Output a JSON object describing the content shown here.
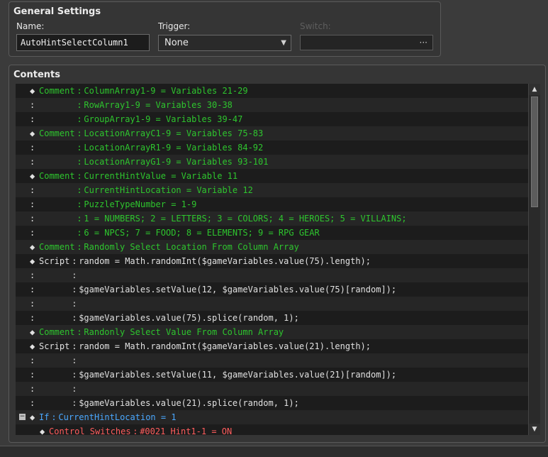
{
  "general": {
    "title": "General Settings",
    "name_label": "Name:",
    "name_value": "AutoHintSelectColumn1",
    "trigger_label": "Trigger:",
    "trigger_value": "None",
    "switch_label": "Switch:",
    "switch_dots": "···"
  },
  "contents": {
    "title": "Contents",
    "rows": [
      {
        "marker": "◆",
        "cmd": "Comment",
        "sep": ":",
        "text": "ColumnArray1-9 = Variables 21-29",
        "color": "green",
        "indent": 0
      },
      {
        "marker": ":",
        "cmd": "",
        "sep": ":",
        "text": "RowArray1-9 = Variables 30-38",
        "color": "green",
        "indent": 0
      },
      {
        "marker": ":",
        "cmd": "",
        "sep": ":",
        "text": "GroupArray1-9 = Variables 39-47",
        "color": "green",
        "indent": 0
      },
      {
        "marker": "◆",
        "cmd": "Comment",
        "sep": ":",
        "text": "LocationArrayC1-9 = Variables 75-83",
        "color": "green",
        "indent": 0
      },
      {
        "marker": ":",
        "cmd": "",
        "sep": ":",
        "text": "LocationArrayR1-9 = Variables 84-92",
        "color": "green",
        "indent": 0
      },
      {
        "marker": ":",
        "cmd": "",
        "sep": ":",
        "text": "LocationArrayG1-9 = Variables 93-101",
        "color": "green",
        "indent": 0
      },
      {
        "marker": "◆",
        "cmd": "Comment",
        "sep": ":",
        "text": "CurrentHintValue = Variable 11",
        "color": "green",
        "indent": 0
      },
      {
        "marker": ":",
        "cmd": "",
        "sep": ":",
        "text": "CurrentHintLocation = Variable 12",
        "color": "green",
        "indent": 0
      },
      {
        "marker": ":",
        "cmd": "",
        "sep": ":",
        "text": "PuzzleTypeNumber = 1-9",
        "color": "green",
        "indent": 0
      },
      {
        "marker": ":",
        "cmd": "",
        "sep": ":",
        "text": "1 = NUMBERS; 2 = LETTERS; 3 = COLORS; 4 = HEROES; 5 = VILLAINS;",
        "color": "green",
        "indent": 0
      },
      {
        "marker": ":",
        "cmd": "",
        "sep": ":",
        "text": "6 = NPCS; 7 = FOOD; 8 = ELEMENTS; 9 = RPG GEAR",
        "color": "green",
        "indent": 0
      },
      {
        "marker": "◆",
        "cmd": "Comment",
        "sep": ":",
        "text": "Randomly Select Location From Column Array",
        "color": "green",
        "indent": 0
      },
      {
        "marker": "◆",
        "cmd": "Script",
        "sep": ":",
        "text": "random = Math.randomInt($gameVariables.value(75).length);",
        "color": "white",
        "indent": 0
      },
      {
        "marker": ":",
        "cmd": "",
        "sep": ":",
        "text": "",
        "color": "white",
        "indent": 0
      },
      {
        "marker": ":",
        "cmd": "",
        "sep": ":",
        "text": "$gameVariables.setValue(12, $gameVariables.value(75)[random]);",
        "color": "white",
        "indent": 0
      },
      {
        "marker": ":",
        "cmd": "",
        "sep": ":",
        "text": "",
        "color": "white",
        "indent": 0
      },
      {
        "marker": ":",
        "cmd": "",
        "sep": ":",
        "text": "$gameVariables.value(75).splice(random, 1);",
        "color": "white",
        "indent": 0
      },
      {
        "marker": "◆",
        "cmd": "Comment",
        "sep": ":",
        "text": "Randonly Select Value From Column Array",
        "color": "green",
        "indent": 0
      },
      {
        "marker": "◆",
        "cmd": "Script",
        "sep": ":",
        "text": "random = Math.randomInt($gameVariables.value(21).length);",
        "color": "white",
        "indent": 0
      },
      {
        "marker": ":",
        "cmd": "",
        "sep": ":",
        "text": "",
        "color": "white",
        "indent": 0
      },
      {
        "marker": ":",
        "cmd": "",
        "sep": ":",
        "text": "$gameVariables.setValue(11, $gameVariables.value(21)[random]);",
        "color": "white",
        "indent": 0
      },
      {
        "marker": ":",
        "cmd": "",
        "sep": ":",
        "text": "",
        "color": "white",
        "indent": 0
      },
      {
        "marker": ":",
        "cmd": "",
        "sep": ":",
        "text": "$gameVariables.value(21).splice(random, 1);",
        "color": "white",
        "indent": 0
      },
      {
        "marker": "◆",
        "cmd": "If",
        "sep": ":",
        "text": "CurrentHintLocation = 1",
        "color": "blue",
        "indent": 0,
        "fold": "−"
      },
      {
        "marker": "◆",
        "cmd": "Control Switches",
        "sep": ":",
        "text": "#0021 Hint1-1 = ON",
        "color": "red",
        "indent": 1
      }
    ]
  },
  "colors": {
    "comment": "#2ec52e",
    "script": "#e0e0e0",
    "conditional": "#4aa8ff",
    "switches": "#ff5d5d"
  },
  "icons": {
    "trigger_arrow": "chevron-down-icon",
    "scroll_up": "triangle-up-icon",
    "scroll_down": "triangle-down-icon",
    "fold": "collapse-icon"
  }
}
